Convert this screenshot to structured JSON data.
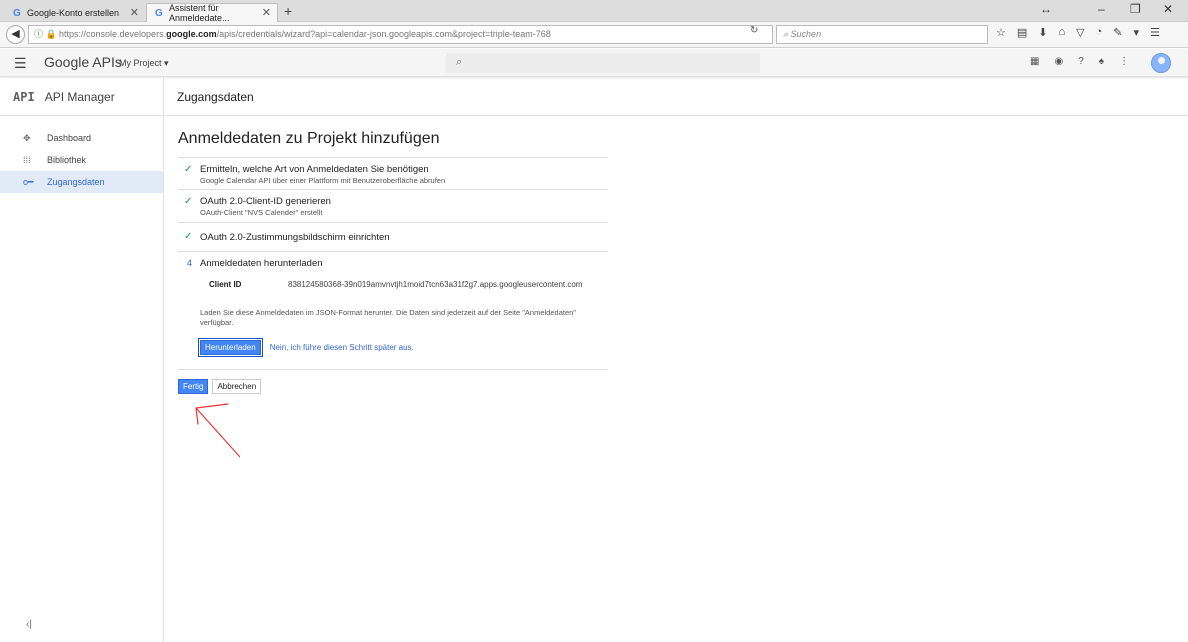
{
  "browser": {
    "tabs": [
      {
        "label": "Google-Konto erstellen",
        "active": false
      },
      {
        "label": "Assistent für Anmeldedate...",
        "active": true
      }
    ],
    "url_prefix": "https://console.developers.",
    "url_domain": "google.com",
    "url_rest": "/apis/credentials/wizard?api=calendar-json.googleapis.com&project=triple-team-768",
    "search_placeholder": "Suchen"
  },
  "header": {
    "brand": "Google APIs",
    "project": "My Project ▾"
  },
  "sidebar": {
    "logo": "API",
    "title": "API Manager",
    "items": [
      {
        "label": "Dashboard",
        "icon": "dashboard-icon",
        "active": false
      },
      {
        "label": "Bibliothek",
        "icon": "library-icon",
        "active": false
      },
      {
        "label": "Zugangsdaten",
        "icon": "key-icon",
        "active": true
      }
    ]
  },
  "main": {
    "section_title": "Zugangsdaten",
    "page_title": "Anmeldedaten zu Projekt hinzufügen",
    "steps": [
      {
        "title": "Ermitteln, welche Art von Anmeldedaten Sie benötigen",
        "desc": "Google Calendar API über einer Plattform mit Benutzeroberfläche abrufen",
        "state": "done"
      },
      {
        "title": "OAuth 2.0-Client-ID generieren",
        "desc": "OAuth-Client \"NVS Calender\" erstellt",
        "state": "done"
      },
      {
        "title": "OAuth 2.0-Zustimmungsbildschirm einrichten",
        "desc": "",
        "state": "done"
      },
      {
        "number": "4",
        "title": "Anmeldedaten herunterladen",
        "state": "current"
      }
    ],
    "client_id_label": "Client ID",
    "client_id_value": "838124580368-39n019amvnvtjh1moid7tcn63a31f2g7.apps.googleusercontent.com",
    "download_text": "Laden Sie diese Anmeldedaten im JSON-Format herunter. Die Daten sind jederzeit auf der Seite \"Anmeldedaten\" verfügbar.",
    "download_button": "Herunterladen",
    "skip_link": "Nein, ich führe diesen Schritt später aus.",
    "done_button": "Fertig",
    "cancel_button": "Abbrechen"
  },
  "colors": {
    "accent": "#4285f4",
    "check": "#0f9d58",
    "annotation": "#e53935",
    "sidebar_active_bg": "#e1ebf8"
  }
}
